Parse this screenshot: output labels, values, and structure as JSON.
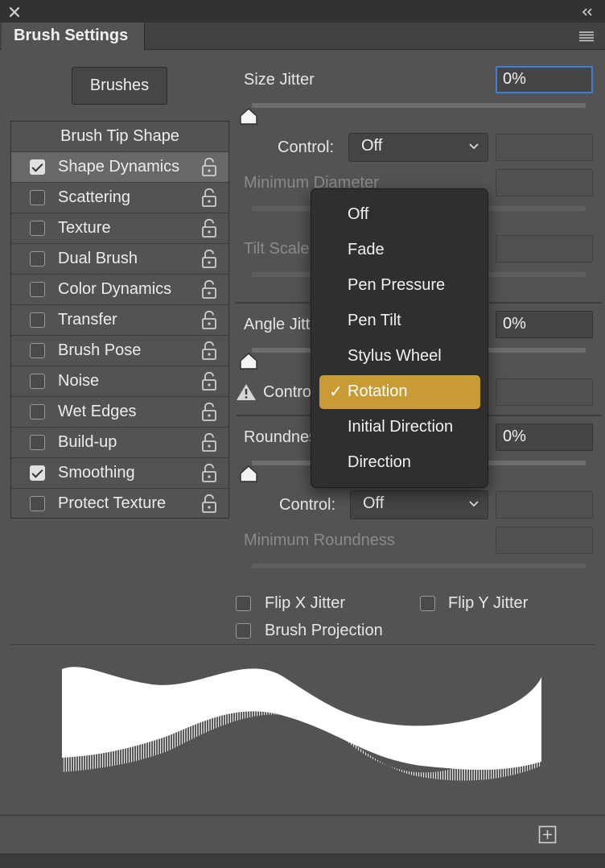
{
  "panel": {
    "title": "Brush Settings",
    "brushes_button": "Brushes"
  },
  "list": {
    "header": "Brush Tip Shape",
    "items": [
      {
        "label": "Shape Dynamics",
        "checked": true
      },
      {
        "label": "Scattering",
        "checked": false
      },
      {
        "label": "Texture",
        "checked": false
      },
      {
        "label": "Dual Brush",
        "checked": false
      },
      {
        "label": "Color Dynamics",
        "checked": false
      },
      {
        "label": "Transfer",
        "checked": false
      },
      {
        "label": "Brush Pose",
        "checked": false
      },
      {
        "label": "Noise",
        "checked": false
      },
      {
        "label": "Wet Edges",
        "checked": false
      },
      {
        "label": "Build-up",
        "checked": false
      },
      {
        "label": "Smoothing",
        "checked": true
      },
      {
        "label": "Protect Texture",
        "checked": false
      }
    ]
  },
  "settings": {
    "size_jitter_label": "Size Jitter",
    "size_jitter_value": "0%",
    "control_label": "Control:",
    "control1_value": "Off",
    "min_diameter_label": "Minimum Diameter",
    "tilt_scale_label": "Tilt Scale",
    "angle_jitter_label": "Angle Jitter",
    "angle_jitter_value": "0%",
    "control2_label": "Control",
    "roundness_label": "Roundness Jitter",
    "roundness_value": "0%",
    "control3_label": "Control:",
    "control3_value": "Off",
    "min_roundness_label": "Minimum Roundness",
    "flip_x_label": "Flip X Jitter",
    "flip_y_label": "Flip Y Jitter",
    "projection_label": "Brush Projection",
    "size_jitter_level": 0,
    "angle_jitter_level": 0,
    "roundness_level": 0
  },
  "menu": {
    "items": [
      "Off",
      "Fade",
      "Pen Pressure",
      "Pen Tilt",
      "Stylus Wheel",
      "Rotation",
      "Initial Direction",
      "Direction"
    ],
    "selected": "Rotation",
    "check_glyph": "✓"
  },
  "colors": {
    "accent_selected": "#c89b35",
    "focus_border": "#3d7fd9",
    "panel_bg": "#535353"
  },
  "icons": {
    "close": "close-icon",
    "collapse": "double-chevron-icon",
    "menu": "hamburger-menu-icon",
    "lock": "unlock-icon",
    "warning": "warning-icon",
    "new": "new-preset-icon"
  }
}
